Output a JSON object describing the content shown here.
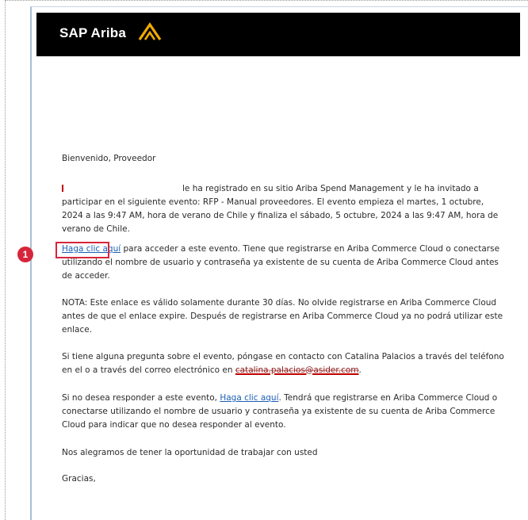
{
  "header": {
    "brand": "SAP Ariba",
    "logo_icon": "ariba-chevron-logo",
    "background_color": "#000000",
    "accent_color": "#f0ab00"
  },
  "email": {
    "greeting": "Bienvenido, Proveedor",
    "invite": {
      "text_a": "le ha registrado en su sitio Ariba Spend Management y le ha invitado a participar en el siguiente evento: RFP - Manual proveedores. El evento empieza el martes, 1 octubre, 2024 a las 9:47 AM, hora de verano de Chile y finaliza el sábado, 5 octubre, 2024 a las 9:47 AM, hora de verano de Chile."
    },
    "access": {
      "link": "Haga clic aquí",
      "text": " para acceder a este evento. Tiene que registrarse en Ariba Commerce Cloud o conectarse utilizando el nombre de usuario y contraseña ya existente de su cuenta de Ariba Commerce Cloud antes de acceder."
    },
    "note": "NOTA: Este enlace es válido solamente durante 30 días. No olvide registrarse en Ariba Commerce Cloud antes de que el enlace expire. Después de registrarse en Ariba Commerce Cloud ya no podrá utilizar este enlace.",
    "contact": {
      "text_a": "Si tiene alguna pregunta sobre el evento, póngase en contacto con Catalina Palacios a través del teléfono en el  o a través del correo electrónico en ",
      "email": "catalina.palacios@asider.com",
      "text_b": "."
    },
    "decline": {
      "text_a": "Si no desea responder a este evento, ",
      "link": "Haga clic aquí",
      "text_b": ". Tendrá que registrarse en Ariba Commerce Cloud o conectarse utilizando el nombre de usuario y contraseña ya existente de su cuenta de Ariba Commerce Cloud para indicar que no desea responder al evento."
    },
    "closing": "Nos alegramos de tener la oportunidad de trabajar con usted",
    "thanks": "Gracias,"
  },
  "annotation": {
    "step_number": "1",
    "color": "#d6263b"
  }
}
